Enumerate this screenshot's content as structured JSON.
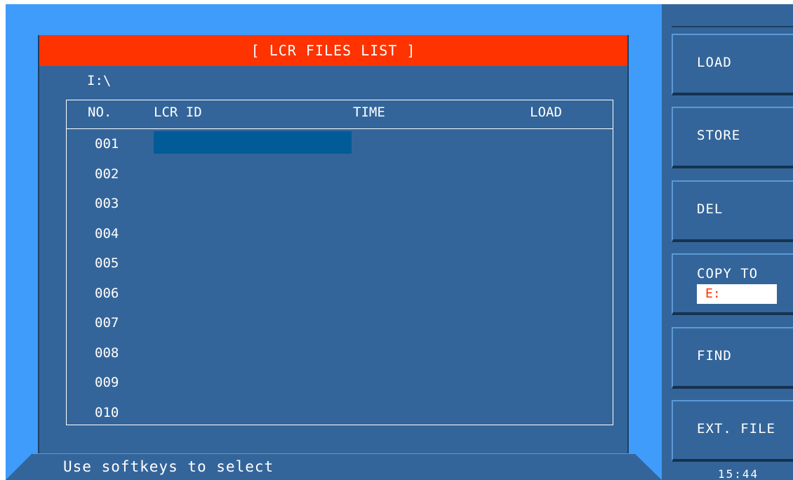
{
  "title": "[ LCR FILES LIST ]",
  "path": "I:\\",
  "table": {
    "headers": {
      "no": "NO.",
      "lcr_id": "LCR ID",
      "time": "TIME",
      "load": "LOAD"
    },
    "rows": [
      {
        "no": "001",
        "lcr_id": "",
        "time": "",
        "load": "",
        "selected": true
      },
      {
        "no": "002",
        "lcr_id": "",
        "time": "",
        "load": "",
        "selected": false
      },
      {
        "no": "003",
        "lcr_id": "",
        "time": "",
        "load": "",
        "selected": false
      },
      {
        "no": "004",
        "lcr_id": "",
        "time": "",
        "load": "",
        "selected": false
      },
      {
        "no": "005",
        "lcr_id": "",
        "time": "",
        "load": "",
        "selected": false
      },
      {
        "no": "006",
        "lcr_id": "",
        "time": "",
        "load": "",
        "selected": false
      },
      {
        "no": "007",
        "lcr_id": "",
        "time": "",
        "load": "",
        "selected": false
      },
      {
        "no": "008",
        "lcr_id": "",
        "time": "",
        "load": "",
        "selected": false
      },
      {
        "no": "009",
        "lcr_id": "",
        "time": "",
        "load": "",
        "selected": false
      },
      {
        "no": "010",
        "lcr_id": "",
        "time": "",
        "load": "",
        "selected": false
      }
    ]
  },
  "softkeys": {
    "load": "LOAD",
    "store": "STORE",
    "del": "DEL",
    "copy_to": "COPY TO",
    "copy_drive": "E:",
    "find": "FIND",
    "ext_file": "EXT. FILE"
  },
  "status": "Use softkeys to select",
  "time": "15:44",
  "colors": {
    "background": "#3f9cfb",
    "panel": "#34659a",
    "title_bar": "#ff3300",
    "selection": "#005b97",
    "drive_text": "#ff3300"
  }
}
